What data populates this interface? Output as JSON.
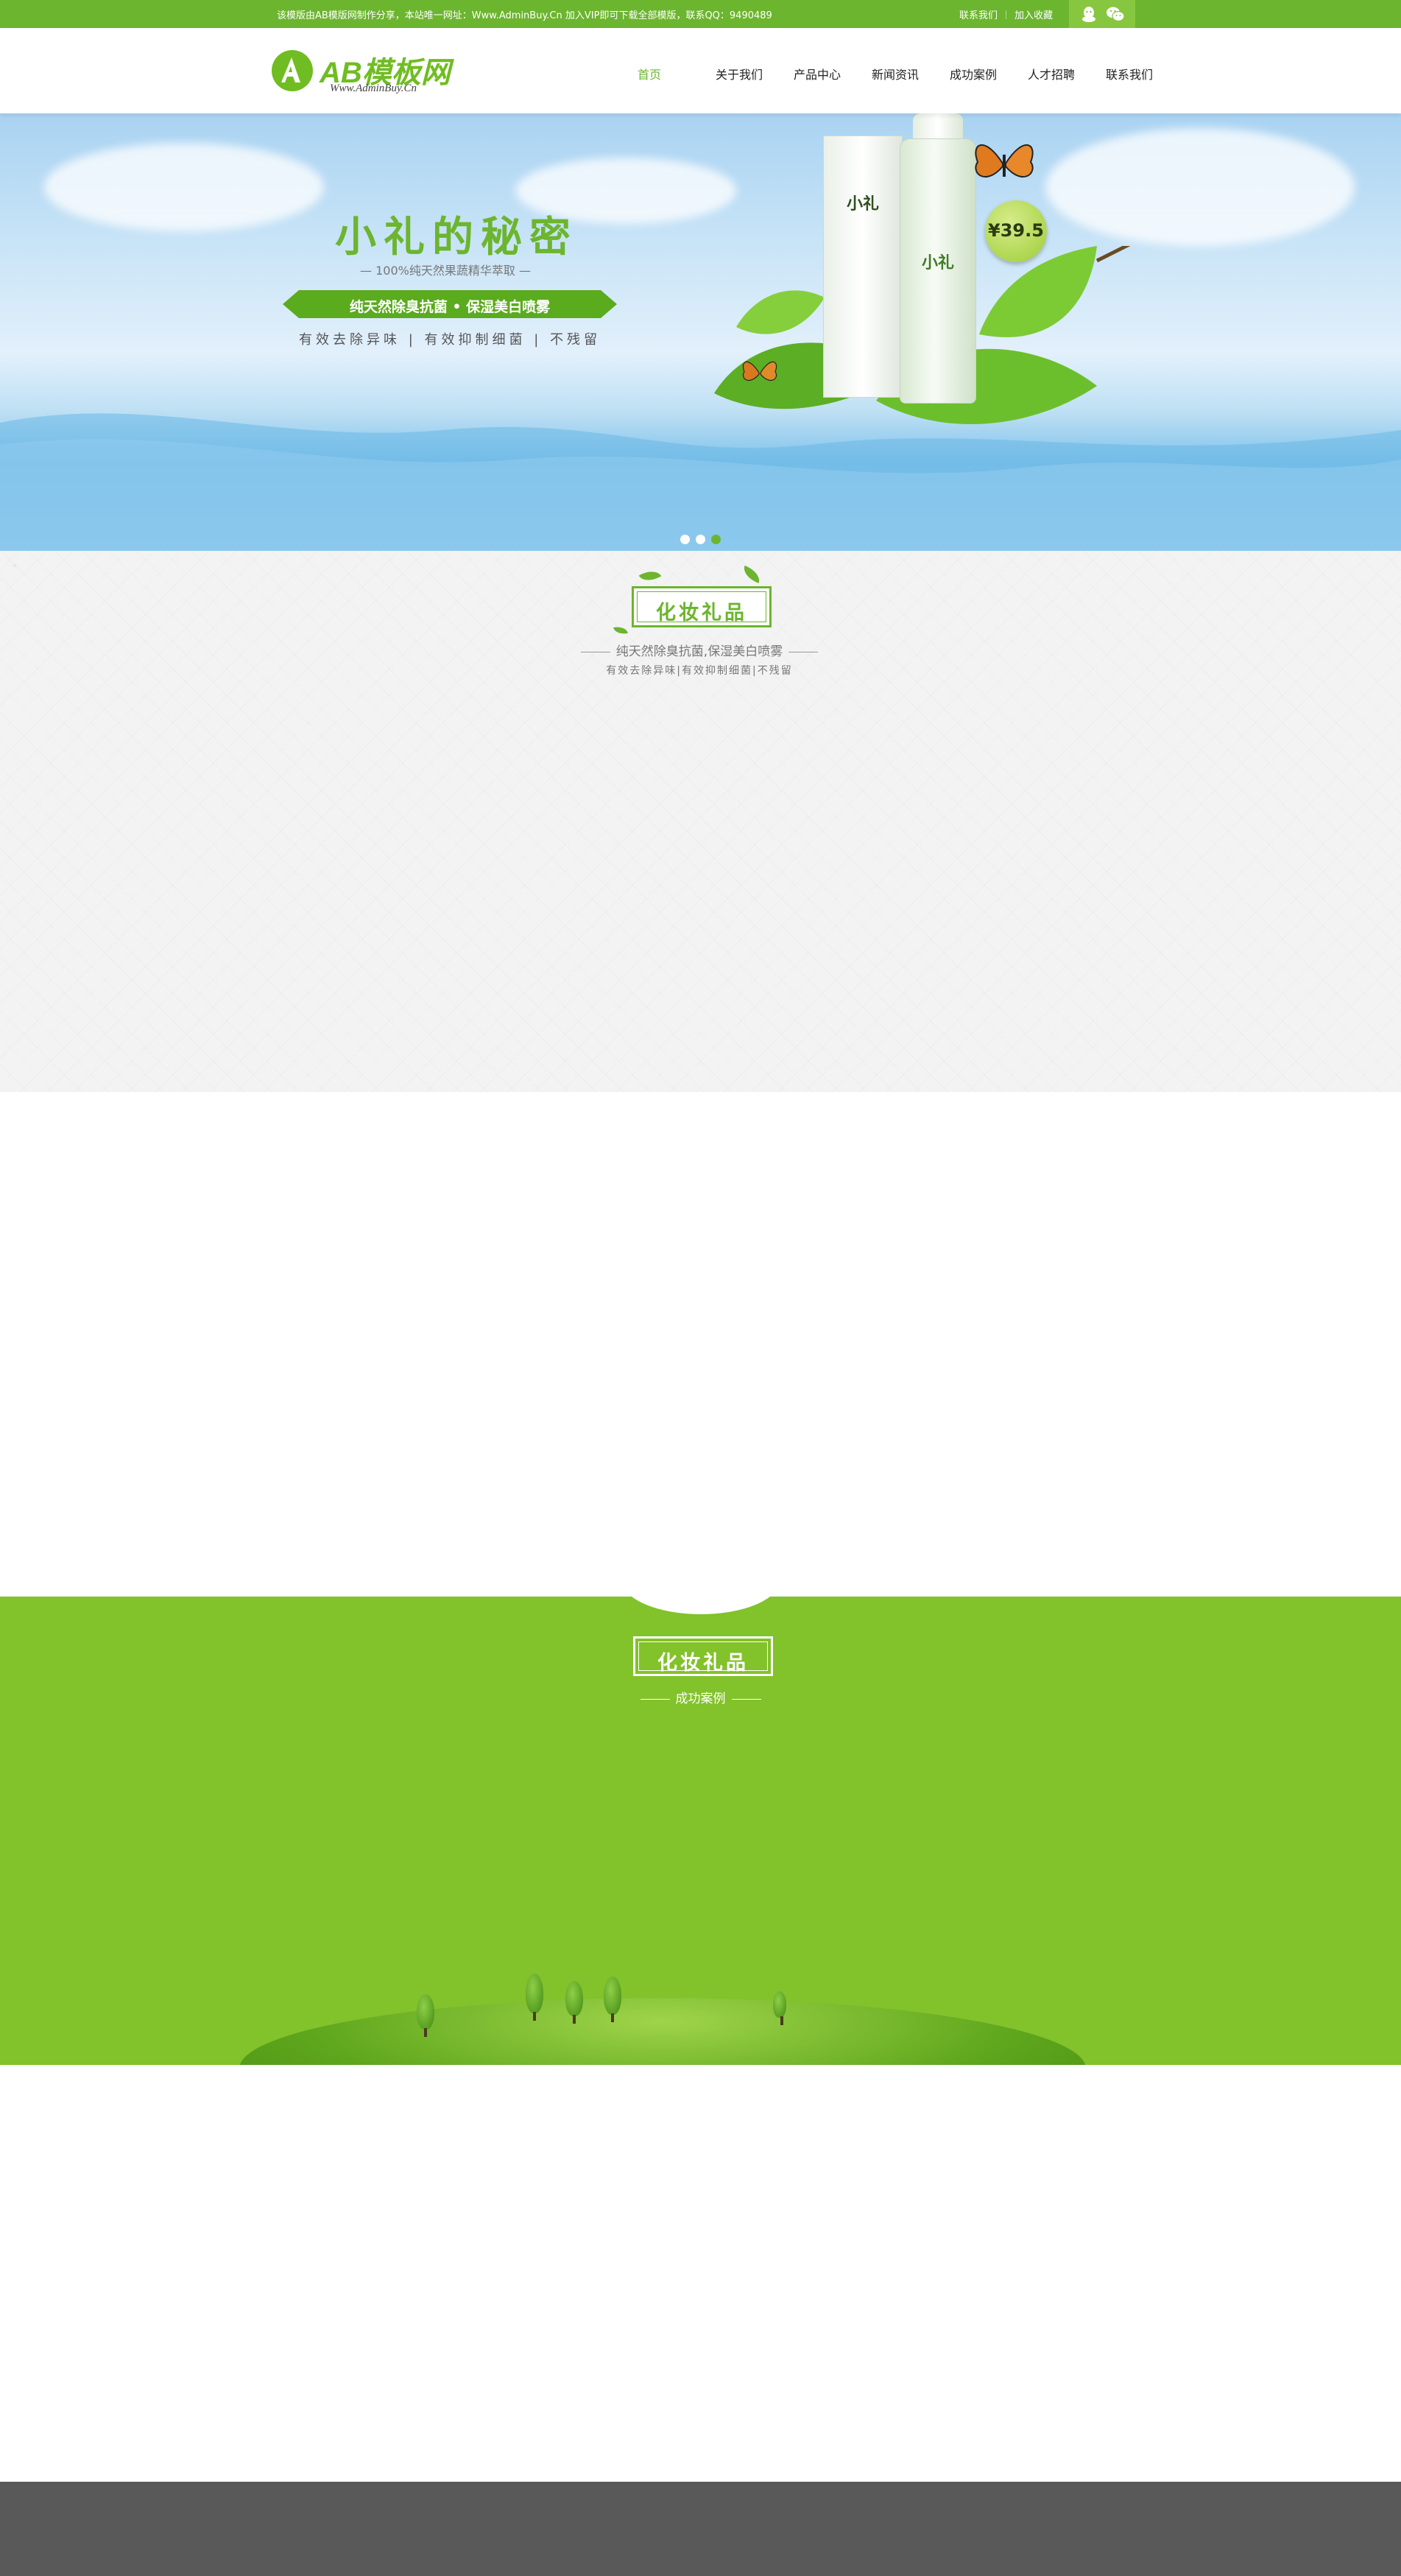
{
  "topbar": {
    "notice": "该模版由AB模版网制作分享，本站唯一网址：Www.AdminBuy.Cn 加入VIP即可下载全部模版，联系QQ：9490489",
    "links": [
      "联系我们",
      "加入收藏"
    ],
    "social_icons": [
      "qq-icon",
      "wechat-icon"
    ],
    "color": "#6cb52e"
  },
  "header": {
    "logo_name": "AB模板网",
    "logo_url": "Www.AdminBuy.Cn",
    "nav": [
      "首页",
      "关于我们",
      "产品中心",
      "新闻资讯",
      "成功案例",
      "人才招聘",
      "联系我们"
    ],
    "active_index": 0
  },
  "banner": {
    "title": "小礼的秘密",
    "subtitle": "— 100%纯天然果蔬精华萃取 —",
    "ribbon": "纯天然除臭抗菌 • 保湿美白喷雾",
    "tagline": "有效去除异味 | 有效抑制细菌 | 不残留",
    "product_name": "小礼",
    "price": "¥39.5",
    "slides": 3,
    "active_slide": 3
  },
  "section_products": {
    "badge": "化妆礼品",
    "subtitle": "纯天然除臭抗菌,保湿美白喷雾",
    "desc": "有效去除异味|有效抑制细菌|不残留"
  },
  "section_cases": {
    "badge": "化妆礼品",
    "subtitle": "成功案例",
    "background": "#82c22a"
  },
  "footer": {
    "background": "#595959"
  }
}
